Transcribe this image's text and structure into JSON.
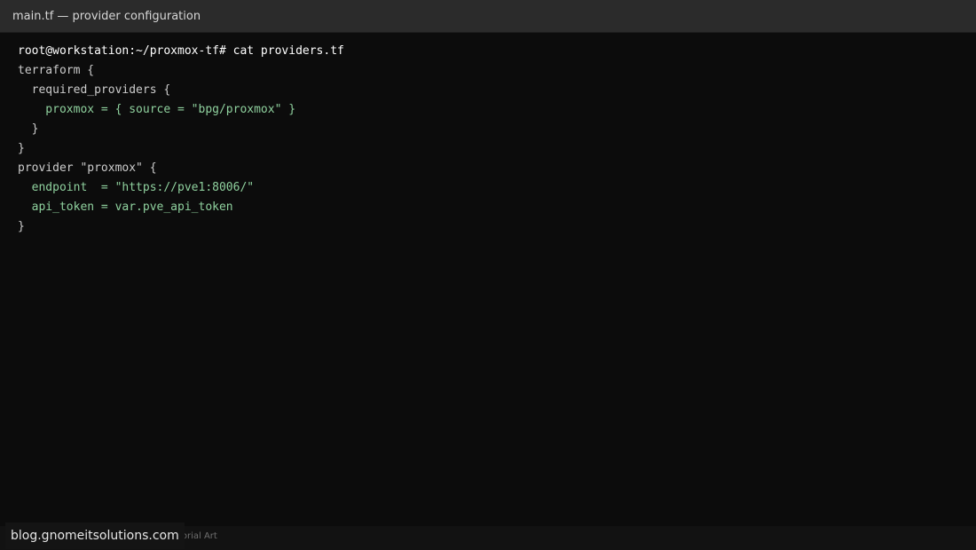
{
  "window": {
    "title": "main.tf — provider configuration"
  },
  "terminal": {
    "prompt": "root@workstation:~/proxmox-tf# cat providers.tf",
    "lines": [
      "terraform {",
      "  required_providers {",
      "    proxmox = { source = \"bpg/proxmox\" }",
      "  }",
      "}",
      "provider \"proxmox\" {",
      "  endpoint  = \"https://pve1:8006/\"",
      "  api_token = var.pve_api_token",
      "}"
    ]
  },
  "footer": {
    "caption": "Tutorial Art",
    "watermark": "blog.gnomeitsolutions.com"
  },
  "colors": {
    "background": "#0c0c0c",
    "titlebar": "#2b2b2b",
    "prompt_text": "#ffffff",
    "code_text": "#cccccc",
    "highlight_green": "#8fd19e"
  }
}
